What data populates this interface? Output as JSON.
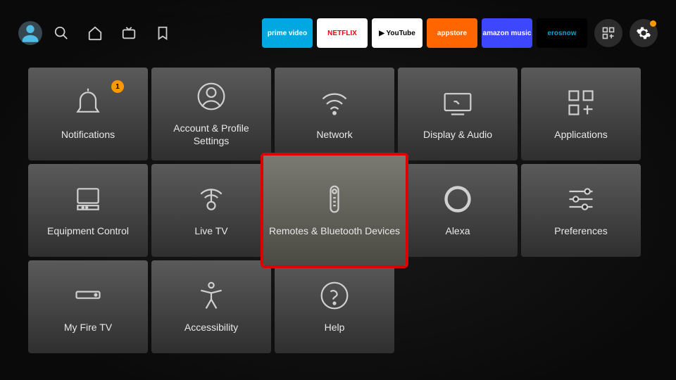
{
  "topbar": {
    "apps": [
      {
        "name": "prime-video",
        "bg": "#00a8e1",
        "label": "prime video",
        "color": "#fff"
      },
      {
        "name": "netflix",
        "bg": "#ffffff",
        "label": "NETFLIX",
        "color": "#e50914"
      },
      {
        "name": "youtube",
        "bg": "#ffffff",
        "label": "▶ YouTube",
        "color": "#000"
      },
      {
        "name": "appstore",
        "bg": "#ff6600",
        "label": "appstore",
        "color": "#fff"
      },
      {
        "name": "amazon-music",
        "bg": "#3c47ff",
        "label": "amazon music",
        "color": "#fff"
      },
      {
        "name": "erosnow",
        "bg": "#000000",
        "label": "erosnow",
        "color": "#0ac"
      }
    ]
  },
  "settings": {
    "tiles": [
      {
        "id": "notifications",
        "label": "Notifications",
        "badge": "1"
      },
      {
        "id": "account",
        "label": "Account & Profile Settings"
      },
      {
        "id": "network",
        "label": "Network"
      },
      {
        "id": "display",
        "label": "Display & Audio"
      },
      {
        "id": "applications",
        "label": "Applications"
      },
      {
        "id": "equipment",
        "label": "Equipment Control"
      },
      {
        "id": "livetv",
        "label": "Live TV"
      },
      {
        "id": "remotes",
        "label": "Remotes & Bluetooth Devices",
        "selected": true
      },
      {
        "id": "alexa",
        "label": "Alexa"
      },
      {
        "id": "preferences",
        "label": "Preferences"
      },
      {
        "id": "myfiretv",
        "label": "My Fire TV"
      },
      {
        "id": "accessibility",
        "label": "Accessibility"
      },
      {
        "id": "help",
        "label": "Help"
      }
    ]
  }
}
